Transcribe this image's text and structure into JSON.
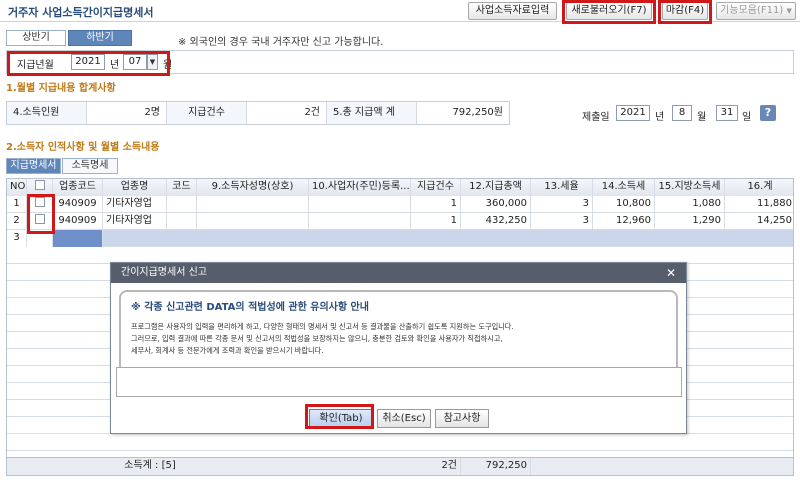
{
  "window": {
    "title": "거주자 사업소득간이지급명세서"
  },
  "toolbar": {
    "btn_business_data": "사업소득자료입력",
    "btn_reload": "새로불러오기(F7)",
    "btn_close": "마감(F4)",
    "btn_functions": "기능모음(F11)",
    "functions_arrow": "▼"
  },
  "half_tabs": {
    "first": "상반기",
    "second": "하반기"
  },
  "notice": "※ 외국인의 경우 국내 거주자만 신고 가능합니다.",
  "period": {
    "label": "지급년월",
    "year": "2021",
    "year_unit": "년",
    "month": "07",
    "month_unit": "월",
    "arrow": "▼"
  },
  "section1": {
    "title": "1.월별 지급내용 합계사항"
  },
  "summary": {
    "earners_label": "4.소득인원",
    "earners_value": "2명",
    "count_label": "지급건수",
    "count_value": "2건",
    "total_label": "5.총 지급액 계",
    "total_value": "792,250원"
  },
  "submit_date": {
    "label": "제출일",
    "year": "2021",
    "year_unit": "년",
    "month": "8",
    "month_unit": "월",
    "day": "31",
    "day_unit": "일",
    "help": "?"
  },
  "section2": {
    "title": "2.소득자 인적사항 및 월별 소득내용"
  },
  "detail_tabs": {
    "statement": "지급명세서",
    "income_list": "소득명세"
  },
  "grid": {
    "columns": [
      "NO",
      "",
      "업종코드",
      "업종명",
      "코드",
      "9.소득자성명(상호)",
      "10.사업자(주민)등록...",
      "지급건수",
      "12.지급총액",
      "13.세율",
      "14.소득세",
      "15.지방소득세",
      "16.계"
    ],
    "rows": [
      {
        "no": "1",
        "code": "940909",
        "name": "기타자영업",
        "count": "1",
        "total": "360,000",
        "rate": "3",
        "income_tax": "10,800",
        "local_tax": "1,080",
        "sum": "11,880"
      },
      {
        "no": "2",
        "code": "940909",
        "name": "기타자영업",
        "count": "1",
        "total": "432,250",
        "rate": "3",
        "income_tax": "12,960",
        "local_tax": "1,290",
        "sum": "14,250"
      },
      {
        "no": "3"
      }
    ],
    "footer": {
      "label": "소득계 : [5]",
      "count": "2건",
      "total": "792,250"
    }
  },
  "dialog": {
    "title": "간이지급명세서 신고",
    "close": "✕",
    "heading": "※ 각종 신고관련 DATA의 적법성에 관한 유의사항 안내",
    "lines": [
      "프로그램은 사용자의 입력을 편리하게 하고, 다양한 형태의 명세서 및 신고서 등 결과물을 산출하기 쉽도록 지원하는 도구입니다.",
      "그러므로, 입력 결과에 따른 각종 문서 및 신고서의 적법성을 보장하지는 않으니, 충분한 검토와 확인을 사용자가 직접하시고,",
      "세무사, 회계사 등 전문가에게 조력과 확인을 받으시기 바랍니다."
    ],
    "btn_ok": "확인(Tab)",
    "btn_cancel": "취소(Esc)",
    "btn_ref": "참고사항"
  },
  "colors": {
    "accent_red": "#d01818",
    "title_blue": "#2a4c7d",
    "section_orange": "#c07a18",
    "selected_row": "#ccd6ea"
  }
}
